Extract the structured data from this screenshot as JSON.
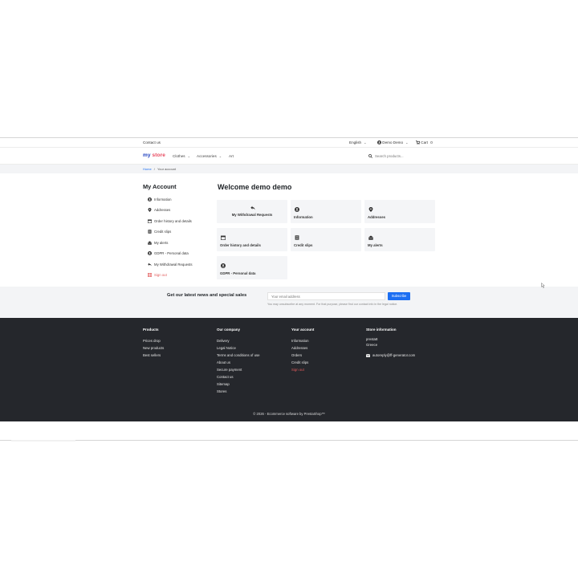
{
  "topbar": {
    "contact": "Contact us",
    "language": "English",
    "user": "Demo Demo",
    "cart_label": "Cart",
    "cart_count": "0"
  },
  "header": {
    "logo_part1": "my",
    "logo_part2": "store",
    "nav": [
      "Clothes",
      "Accessories",
      "Art"
    ],
    "search_placeholder": "Search products..."
  },
  "breadcrumb": {
    "home": "Home",
    "separator": "/",
    "current": "Your account"
  },
  "sidebar": {
    "title": "My Account",
    "items": [
      {
        "label": "Information",
        "icon": "person-circle-icon"
      },
      {
        "label": "Addresses",
        "icon": "location-pin-icon"
      },
      {
        "label": "Order history and details",
        "icon": "calendar-icon"
      },
      {
        "label": "Credit slips",
        "icon": "receipt-icon"
      },
      {
        "label": "My alerts",
        "icon": "envelope-open-icon"
      },
      {
        "label": "GDPR - Personal data",
        "icon": "account-circle-icon"
      },
      {
        "label": "My Withdrawal Requests",
        "icon": "reply-arrow-icon"
      },
      {
        "label": "Sign out",
        "icon": "grid-icon"
      }
    ]
  },
  "main": {
    "welcome": "Welcome demo demo",
    "cards": [
      {
        "label": "My Withdrawal Requests",
        "icon": "reply-arrow-icon"
      },
      {
        "label": "Information",
        "icon": "person-circle-icon"
      },
      {
        "label": "Addresses",
        "icon": "location-pin-icon"
      },
      {
        "label": "Order history and details",
        "icon": "calendar-icon"
      },
      {
        "label": "Credit slips",
        "icon": "receipt-icon"
      },
      {
        "label": "My alerts",
        "icon": "envelope-open-icon"
      },
      {
        "label": "GDPR - Personal data",
        "icon": "account-circle-icon"
      }
    ]
  },
  "newsletter": {
    "title": "Get our latest news and special sales",
    "placeholder": "Your email address",
    "button": "Subscribe",
    "note": "You may unsubscribe at any moment. For that purpose, please find our contact info in the legal notice."
  },
  "footer": {
    "products": {
      "title": "Products",
      "links": [
        "Prices drop",
        "New products",
        "Best sellers"
      ]
    },
    "company": {
      "title": "Our company",
      "links": [
        "Delivery",
        "Legal Notice",
        "Terms and conditions of use",
        "About us",
        "Secure payment",
        "Contact us",
        "Sitemap",
        "Stores"
      ]
    },
    "account": {
      "title": "Your account",
      "links": [
        "Information",
        "Addresses",
        "Orders",
        "Credit slips",
        "Sign out"
      ]
    },
    "store": {
      "title": "Store information",
      "name": "presta8",
      "country": "Greece",
      "email": "autoreply@ff-generator.com"
    },
    "copyright": "© 2026 - Ecommerce software by PrestaShop™"
  },
  "colors": {
    "accent": "#1d6ff2",
    "logo_blue": "#1d3fbf",
    "logo_pink": "#e8485e",
    "signout": "#e25b5b",
    "footer_bg": "#25272c"
  }
}
